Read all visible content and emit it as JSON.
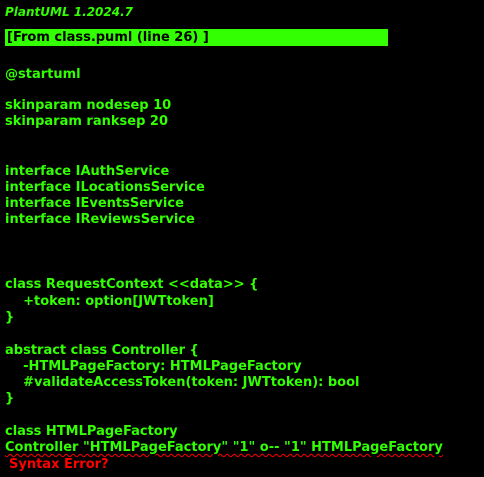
{
  "header": {
    "version": "PlantUML 1.2024.7",
    "source_label": "[From class.puml (line 26) ]"
  },
  "code": {
    "startuml": "@startuml",
    "skin1": "skinparam nodesep 10",
    "skin2": "skinparam ranksep 20",
    "iface1": "interface IAuthService",
    "iface2": "interface ILocationsService",
    "iface3": "interface IEventsService",
    "iface4": "interface IReviewsService",
    "class1_open": "class RequestContext <<data>> {",
    "class1_field": "    +token: option[JWTtoken]",
    "class1_close": "}",
    "class2_open": "abstract class Controller {",
    "class2_field1": "    -HTMLPageFactory: HTMLPageFactory",
    "class2_field2": "    #validateAccessToken(token: JWTtoken): bool",
    "class2_close": "}",
    "class3": "class HTMLPageFactory",
    "error_line": "Controller \"HTMLPageFactory\" \"1\" o-- \"1\" HTMLPageFactory"
  },
  "error": {
    "message": "Syntax Error?"
  },
  "colors": {
    "background": "#000000",
    "text": "#33FF02",
    "error": "#FF0000"
  }
}
